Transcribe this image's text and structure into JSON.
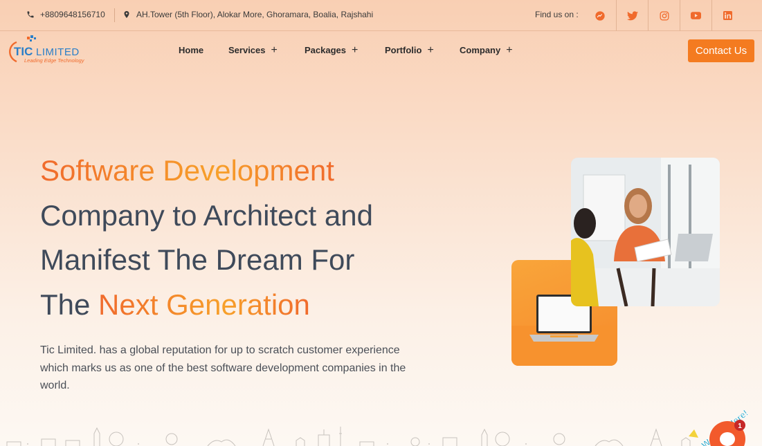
{
  "topbar": {
    "phone": "+8809648156710",
    "address": "AH.Tower (5th Floor), Alokar More, Ghoramara, Boalia, Rajshahi",
    "find_us": "Find us on :",
    "socials": [
      "messenger-icon",
      "twitter-icon",
      "instagram-icon",
      "youtube-icon",
      "linkedin-icon"
    ]
  },
  "logo": {
    "name": "TIC LIMITED",
    "tagline": "Leading Edge Technology"
  },
  "nav": {
    "items": [
      {
        "label": "Home",
        "has_submenu": false
      },
      {
        "label": "Services",
        "has_submenu": true
      },
      {
        "label": "Packages",
        "has_submenu": true
      },
      {
        "label": "Portfolio",
        "has_submenu": true
      },
      {
        "label": "Company",
        "has_submenu": true
      }
    ],
    "plus": "+",
    "contact_label": "Contact Us"
  },
  "hero": {
    "title_1": "Software Development",
    "title_2": "Company to Architect and",
    "title_3": "Manifest The Dream For",
    "title_4a": "The ",
    "title_4b": "Next Generation",
    "description": "Tic Limited. has a global reputation for up to scratch customer experience which marks us as one of the best software development companies in the world."
  },
  "chat": {
    "label": "We Are Here!",
    "badge_count": "1"
  },
  "colors": {
    "accent": "#f47b20",
    "gradient_start": "#f06a2c",
    "gradient_end": "#f7a02a",
    "text": "#3f4a5a"
  }
}
